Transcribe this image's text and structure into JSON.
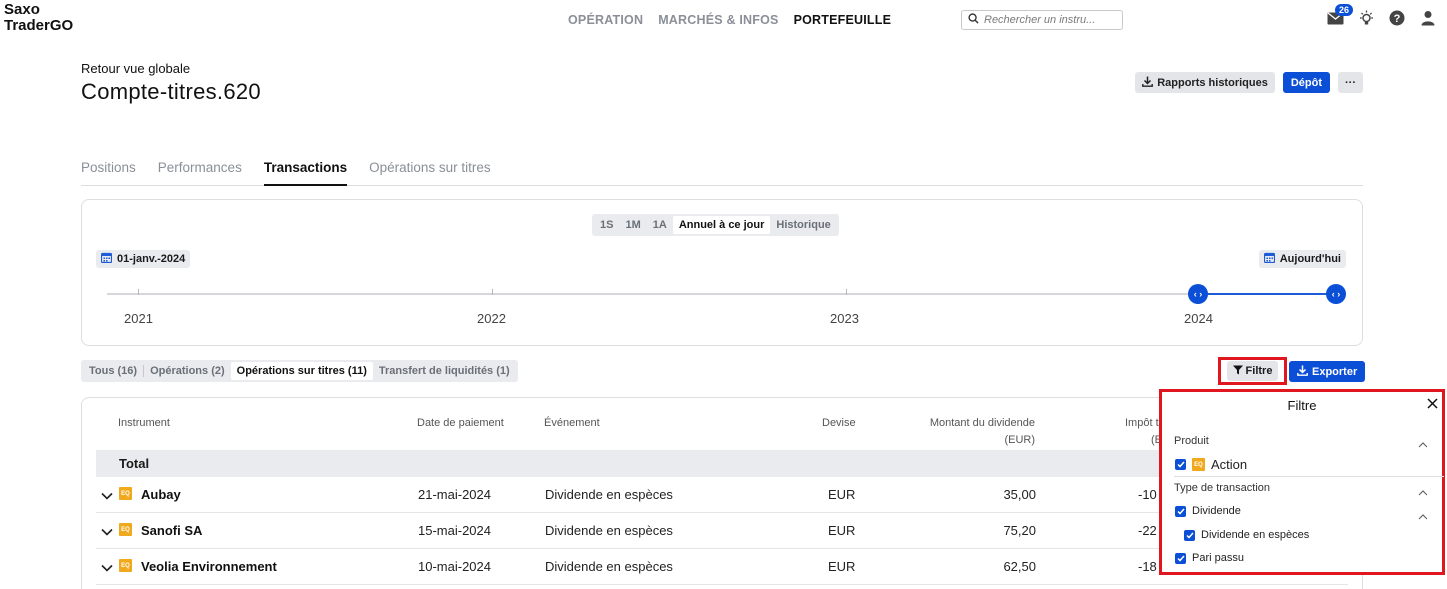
{
  "app": {
    "logo_line1": "Saxo",
    "logo_line2": "TraderGO"
  },
  "topnav": {
    "items": [
      {
        "label": "OPÉRATION",
        "active": false
      },
      {
        "label": "MARCHÉS & INFOS",
        "active": false
      },
      {
        "label": "PORTEFEUILLE",
        "active": true
      }
    ],
    "search_placeholder": "Rechercher un instru...",
    "notification_count": "26",
    "icons": [
      "mail-icon",
      "bulb-icon",
      "help-icon",
      "user-icon"
    ]
  },
  "header": {
    "back_label": "Retour vue globale",
    "title": "Compte-titres.620",
    "reports_label": "Rapports historiques",
    "deposit_label": "Dépôt",
    "more_label": "···"
  },
  "tabs": [
    {
      "label": "Positions",
      "active": false
    },
    {
      "label": "Performances",
      "active": false
    },
    {
      "label": "Transactions",
      "active": true
    },
    {
      "label": "Opérations sur titres",
      "active": false
    }
  ],
  "timeline": {
    "periods": [
      {
        "label": "1S",
        "active": false
      },
      {
        "label": "1M",
        "active": false
      },
      {
        "label": "1A",
        "active": false
      },
      {
        "label": "Annuel à ce jour",
        "active": true
      },
      {
        "label": "Historique",
        "active": false
      }
    ],
    "start_date": "01-janv.-2024",
    "end_date": "Aujourd'hui",
    "years": [
      "2021",
      "2022",
      "2023",
      "2024"
    ]
  },
  "subtabs": [
    {
      "label": "Tous (16)",
      "active": false
    },
    {
      "label": "Opérations (2)",
      "active": false
    },
    {
      "label": "Opérations sur titres (11)",
      "active": true
    },
    {
      "label": "Transfert de liquidités (1)",
      "active": false
    }
  ],
  "actions": {
    "filter_label": "Filtre",
    "export_label": "Exporter"
  },
  "table": {
    "headers": {
      "instrument": "Instrument",
      "payment_date": "Date de paiement",
      "event": "Événement",
      "currency": "Devise",
      "dividend_amount_line1": "Montant du dividende",
      "dividend_amount_line2": "(EUR)",
      "tax_line1": "Impôt t",
      "tax_line2": "(E"
    },
    "total_label": "Total",
    "rows": [
      {
        "tag": "EQ",
        "instrument": "Aubay",
        "date": "21-mai-2024",
        "event": "Dividende en espèces",
        "currency": "EUR",
        "amount": "35,00",
        "tax": "-10"
      },
      {
        "tag": "EQ",
        "instrument": "Sanofi SA",
        "date": "15-mai-2024",
        "event": "Dividende en espèces",
        "currency": "EUR",
        "amount": "75,20",
        "tax": "-22"
      },
      {
        "tag": "EQ",
        "instrument": "Veolia Environnement",
        "date": "10-mai-2024",
        "event": "Dividende en espèces",
        "currency": "EUR",
        "amount": "62,50",
        "tax": "-18"
      }
    ]
  },
  "filter_panel": {
    "title": "Filtre",
    "product_section": "Produit",
    "product_tag": "EQ",
    "product_item": "Action",
    "type_section": "Type de transaction",
    "type_item": "Dividende",
    "type_subitem": "Dividende en espèces",
    "type_item2": "Pari passu"
  },
  "colors": {
    "accent": "#0a4fd6",
    "highlight_border": "#e0171f",
    "equity_tag": "#f0a81c"
  }
}
